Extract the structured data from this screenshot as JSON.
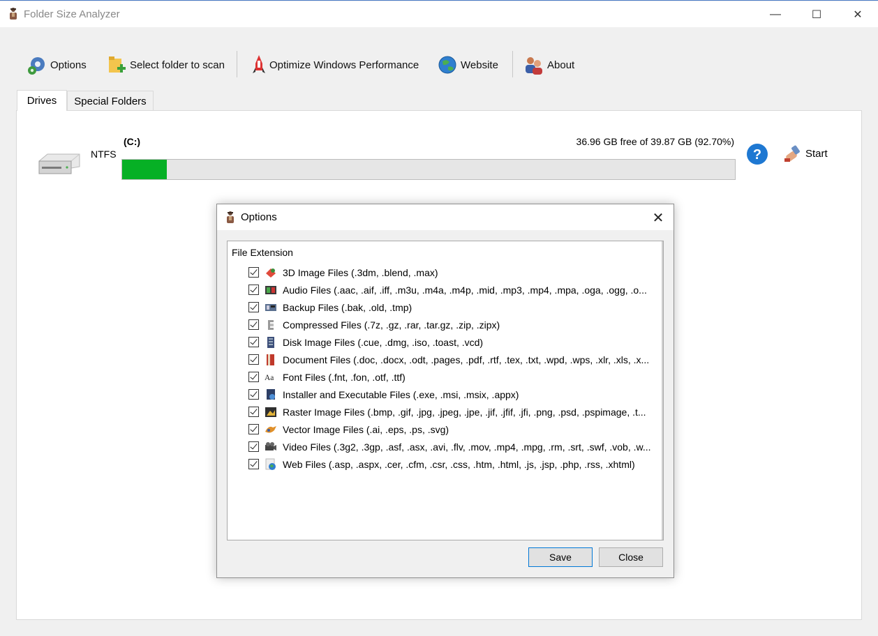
{
  "window": {
    "title": "Folder Size Analyzer",
    "minimize": "—",
    "maximize": "☐",
    "close": "✕"
  },
  "toolbar": {
    "options_label": "Options",
    "select_folder_label": "Select folder to scan",
    "optimize_label": "Optimize Windows Performance",
    "website_label": "Website",
    "about_label": "About"
  },
  "tabs": [
    {
      "label": "Drives",
      "active": true
    },
    {
      "label": "Special Folders",
      "active": false
    }
  ],
  "drive": {
    "filesystem": "NTFS",
    "name": "(C:)",
    "free_text": "36.96 GB free of 39.87 GB (92.70%)",
    "used_fraction": 0.073,
    "start_label": "Start"
  },
  "dialog": {
    "title": "Options",
    "close": "✕",
    "list_header": "File Extension",
    "items": [
      {
        "label": "3D Image Files (.3dm, .blend, .max)",
        "checked": true,
        "icon": "3d-icon"
      },
      {
        "label": "Audio Files (.aac, .aif, .iff, .m3u, .m4a, .m4p, .mid, .mp3, .mp4, .mpa, .oga, .ogg, .o...",
        "checked": true,
        "icon": "audio-icon"
      },
      {
        "label": "Backup Files (.bak, .old, .tmp)",
        "checked": true,
        "icon": "backup-icon"
      },
      {
        "label": "Compressed Files (.7z, .gz, .rar, .tar.gz, .zip, .zipx)",
        "checked": true,
        "icon": "compressed-icon"
      },
      {
        "label": "Disk Image Files (.cue, .dmg, .iso, .toast, .vcd)",
        "checked": true,
        "icon": "disk-image-icon"
      },
      {
        "label": "Document Files (.doc, .docx, .odt, .pages, .pdf, .rtf, .tex, .txt, .wpd, .wps, .xlr, .xls, .x...",
        "checked": true,
        "icon": "document-icon"
      },
      {
        "label": "Font Files (.fnt, .fon, .otf, .ttf)",
        "checked": true,
        "icon": "font-icon"
      },
      {
        "label": "Installer and Executable Files (.exe, .msi, .msix, .appx)",
        "checked": true,
        "icon": "installer-icon"
      },
      {
        "label": "Raster Image Files (.bmp, .gif, .jpg, .jpeg, .jpe, .jif, .jfif, .jfi, .png, .psd, .pspimage, .t...",
        "checked": true,
        "icon": "raster-image-icon"
      },
      {
        "label": "Vector Image Files (.ai, .eps, .ps, .svg)",
        "checked": true,
        "icon": "vector-image-icon"
      },
      {
        "label": "Video Files (.3g2, .3gp, .asf, .asx, .avi, .flv, .mov, .mp4, .mpg, .rm, .srt, .swf, .vob, .w...",
        "checked": true,
        "icon": "video-icon"
      },
      {
        "label": "Web Files (.asp, .aspx, .cer, .cfm, .csr, .css, .htm, .html, .js, .jsp, .php, .rss, .xhtml)",
        "checked": true,
        "icon": "web-icon"
      }
    ],
    "save_label": "Save",
    "close_label": "Close"
  },
  "colors": {
    "usage_fill": "#06b025",
    "accent": "#0078d7"
  }
}
